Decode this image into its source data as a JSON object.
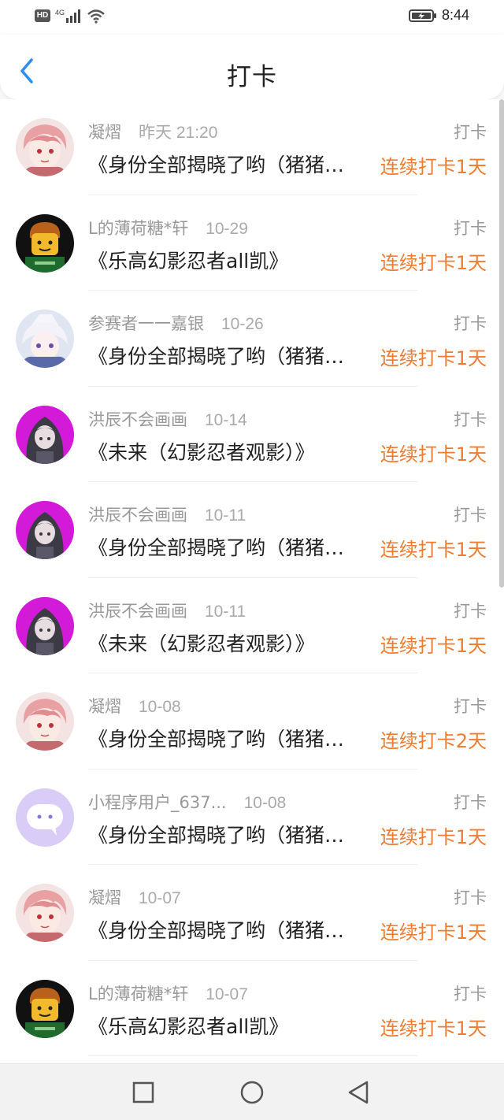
{
  "status_bar": {
    "network": "HD",
    "cell": "4G",
    "time": "8:44"
  },
  "header": {
    "title": "打卡"
  },
  "colors": {
    "accent": "#f07c32",
    "back_icon": "#2b8ef3"
  },
  "items": [
    {
      "username": "凝熠",
      "time": "昨天 21:20",
      "tag": "打卡",
      "book": "《身份全部揭晓了哟（猪猪侠大冒险）》",
      "streak": "连续打卡1天",
      "avatar": "pink-hair-avatar"
    },
    {
      "username": "L的薄荷糖*轩",
      "time": "10-29",
      "tag": "打卡",
      "book": "《乐高幻影忍者all凯》",
      "streak": "连续打卡1天",
      "avatar": "lego-avatar"
    },
    {
      "username": "参赛者一一嘉银",
      "time": "10-26",
      "tag": "打卡",
      "book": "《身份全部揭晓了哟（猪猪侠大冒险）》",
      "streak": "连续打卡1天",
      "avatar": "white-hair-avatar"
    },
    {
      "username": "洪辰不会画画",
      "time": "10-14",
      "tag": "打卡",
      "book": "《未来（幻影忍者观影）》",
      "streak": "连续打卡1天",
      "avatar": "purple-hood-avatar"
    },
    {
      "username": "洪辰不会画画",
      "time": "10-11",
      "tag": "打卡",
      "book": "《身份全部揭晓了哟（猪猪侠大冒险）》",
      "streak": "连续打卡1天",
      "avatar": "purple-hood-avatar"
    },
    {
      "username": "洪辰不会画画",
      "time": "10-11",
      "tag": "打卡",
      "book": "《未来（幻影忍者观影）》",
      "streak": "连续打卡1天",
      "avatar": "purple-hood-avatar"
    },
    {
      "username": "凝熠",
      "time": "10-08",
      "tag": "打卡",
      "book": "《身份全部揭晓了哟（猪猪侠大冒险）》",
      "streak": "连续打卡2天",
      "avatar": "pink-hair-avatar"
    },
    {
      "username": "小程序用户_637...",
      "time": "10-08",
      "tag": "打卡",
      "book": "《身份全部揭晓了哟（猪猪侠大冒险）》",
      "streak": "连续打卡1天",
      "avatar": "chat-bubble-avatar"
    },
    {
      "username": "凝熠",
      "time": "10-07",
      "tag": "打卡",
      "book": "《身份全部揭晓了哟（猪猪侠大冒险）》",
      "streak": "连续打卡1天",
      "avatar": "pink-hair-avatar"
    },
    {
      "username": "L的薄荷糖*轩",
      "time": "10-07",
      "tag": "打卡",
      "book": "《乐高幻影忍者all凯》",
      "streak": "连续打卡1天",
      "avatar": "lego-avatar"
    }
  ],
  "nav_bar": {
    "buttons": [
      "recents-square-icon",
      "home-circle-icon",
      "back-triangle-icon"
    ]
  }
}
